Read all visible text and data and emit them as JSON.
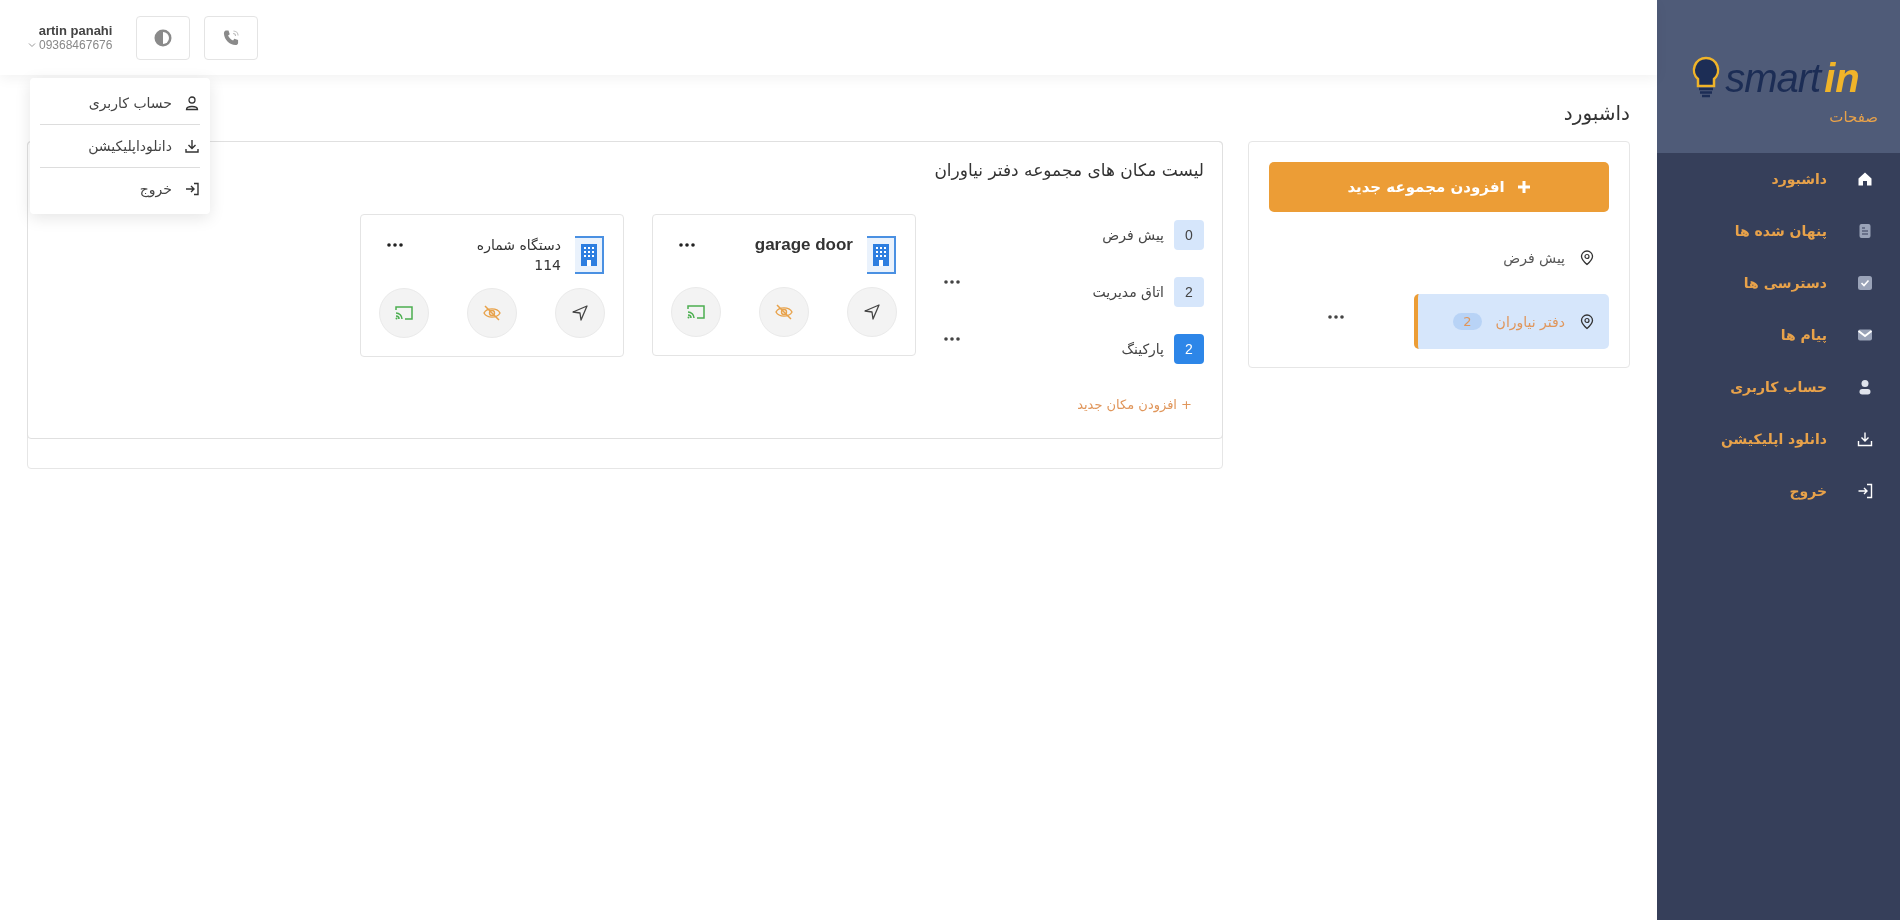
{
  "header": {
    "user_name": "artin panahi",
    "phone": "09368467676"
  },
  "user_menu": [
    {
      "label": "حساب کاربری"
    },
    {
      "label": "دانلوداپلیکیشن"
    },
    {
      "label": "خروج"
    }
  ],
  "page_title": "داشبورد",
  "groups_panel": {
    "add_button": "افزودن مجموعه جدید",
    "groups": [
      {
        "name": "پیش فرض",
        "selected": false,
        "menu": false
      },
      {
        "name": "دفتر نیاوران",
        "count": "2",
        "selected": true,
        "menu": true
      }
    ]
  },
  "locations_card": {
    "title": "لیست مکان های مجموعه دفتر نیاوران",
    "locations": [
      {
        "count": "0",
        "name": "پیش فرض",
        "selected": false,
        "menu": false
      },
      {
        "count": "2",
        "name": "اتاق مدیریت",
        "selected": false,
        "menu": true
      },
      {
        "count": "2",
        "name": "پارکینگ",
        "selected": true,
        "menu": true
      }
    ],
    "add_link": "+ افزودن مکان جدید",
    "devices": [
      {
        "name": "garage door",
        "bold": true
      },
      {
        "name": "دستگاه شماره 114",
        "bold": false
      }
    ]
  },
  "sidebar": {
    "logo_main": "smart",
    "logo_accent": "in",
    "section": "صفحات",
    "items": [
      {
        "label": "داشبورد"
      },
      {
        "label": "پنهان شده ها"
      },
      {
        "label": "دسترسی ها"
      },
      {
        "label": "پیام ها"
      },
      {
        "label": "حساب کاربری"
      },
      {
        "label": "دانلود اپلیکیشن"
      },
      {
        "label": "خروج"
      }
    ]
  }
}
